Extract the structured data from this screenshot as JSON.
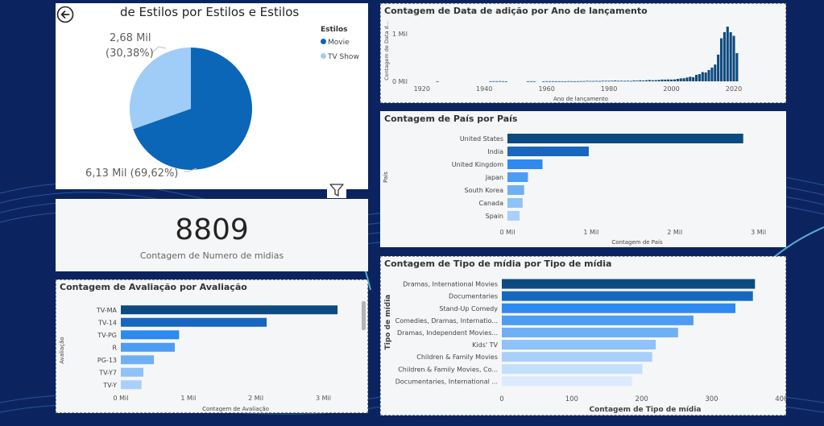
{
  "colors": {
    "background": "#0b2460",
    "movie": "#0b66b8",
    "tvshow": "#9fcdf8",
    "dark": "#0d4a80",
    "bar_palette": [
      "#0d4a80",
      "#1767c0",
      "#2e8af0",
      "#4e9cf2",
      "#6fb0f5",
      "#8ec2f8",
      "#a8d0fa",
      "#c4dffb",
      "#dbeafd"
    ]
  },
  "icons": {
    "back": "back-arrow-icon",
    "filter": "filter-icon",
    "more": "more-options-icon"
  },
  "pie": {
    "title": "Contagem de Estilos por Estilos e Estilos",
    "title_visible": "de Estilos por Estilos e Estilos",
    "legend_title": "Estilos",
    "label_tv_line1": "2,68 Mil",
    "label_tv_line2": "(30,38%)",
    "label_movie": "6,13 Mil (69,62%)",
    "chart_data": {
      "type": "pie",
      "slices": [
        {
          "name": "Movie",
          "value": 6130,
          "percent": 69.62
        },
        {
          "name": "TV Show",
          "value": 2680,
          "percent": 30.38
        }
      ]
    }
  },
  "kpi": {
    "value": "8809",
    "label": "Contagem de Numero de midias"
  },
  "rating": {
    "title": "Contagem de Avaliação por Avaliação",
    "chart_data": {
      "type": "bar",
      "orientation": "horizontal",
      "categories": [
        "TV-MA",
        "TV-14",
        "TV-PG",
        "R",
        "PG-13",
        "TV-Y7",
        "TV-Y"
      ],
      "values": [
        3210,
        2160,
        863,
        799,
        490,
        334,
        307
      ],
      "xlim": [
        0,
        3400
      ],
      "xticks": [
        0,
        1000,
        2000,
        3000
      ],
      "xtick_labels": [
        "0 Mil",
        "1 Mil",
        "2 Mil",
        "3 Mil"
      ],
      "xlabel": "Contagem de Avaliação",
      "ylabel": "Avaliação"
    }
  },
  "year": {
    "title": "Contagem de Data de adição por Ano de lançamento",
    "chart_data": {
      "type": "bar",
      "x": [
        1925,
        1942,
        1943,
        1944,
        1945,
        1946,
        1947,
        1954,
        1955,
        1956,
        1959,
        1960,
        1961,
        1962,
        1963,
        1964,
        1965,
        1966,
        1967,
        1968,
        1969,
        1970,
        1971,
        1972,
        1973,
        1974,
        1975,
        1976,
        1977,
        1978,
        1979,
        1980,
        1981,
        1982,
        1983,
        1984,
        1985,
        1986,
        1987,
        1988,
        1989,
        1990,
        1991,
        1992,
        1993,
        1994,
        1995,
        1996,
        1997,
        1998,
        1999,
        2000,
        2001,
        2002,
        2003,
        2004,
        2005,
        2006,
        2007,
        2008,
        2009,
        2010,
        2011,
        2012,
        2013,
        2014,
        2015,
        2016,
        2017,
        2018,
        2019,
        2020,
        2021
      ],
      "values": [
        1,
        2,
        3,
        3,
        4,
        3,
        1,
        2,
        3,
        2,
        1,
        4,
        3,
        3,
        2,
        2,
        2,
        1,
        5,
        3,
        2,
        3,
        5,
        5,
        10,
        7,
        7,
        9,
        7,
        12,
        11,
        11,
        13,
        17,
        11,
        12,
        10,
        13,
        8,
        18,
        16,
        22,
        17,
        23,
        28,
        22,
        25,
        29,
        38,
        36,
        39,
        37,
        40,
        51,
        61,
        64,
        80,
        96,
        88,
        136,
        152,
        194,
        185,
        237,
        288,
        352,
        560,
        902,
        1032,
        1147,
        1030,
        953,
        592
      ],
      "xlim": [
        1918,
        2028
      ],
      "ylim": [
        0,
        1300
      ],
      "xticks": [
        1920,
        1940,
        1960,
        1980,
        2000,
        2020
      ],
      "yticks": [
        0,
        1000
      ],
      "ytick_labels": [
        "0 Mil",
        "1 Mil"
      ],
      "xlabel": "Ano de lançamento",
      "ylabel": "Contagem de Data d..."
    }
  },
  "country": {
    "title": "Contagem de País por País",
    "chart_data": {
      "type": "bar",
      "orientation": "horizontal",
      "categories": [
        "United States",
        "India",
        "United Kingdom",
        "Japan",
        "South Korea",
        "Canada",
        "Spain"
      ],
      "values": [
        2818,
        972,
        419,
        245,
        199,
        181,
        145
      ],
      "xlim": [
        0,
        3100
      ],
      "xticks": [
        0,
        1000,
        2000,
        3000
      ],
      "xtick_labels": [
        "0 Mil",
        "1 Mil",
        "2 Mil",
        "3 Mil"
      ],
      "xlabel": "Contagem de País",
      "ylabel": "País"
    }
  },
  "genre": {
    "title": "Contagem de Tipo de mídia por Tipo de mídia",
    "chart_data": {
      "type": "bar",
      "orientation": "horizontal",
      "categories": [
        "Dramas, International Movies",
        "Documentaries",
        "Stand-Up Comedy",
        "Comedies, Dramas, Internatio...",
        "Dramas, Independent Movies...",
        "Kids' TV",
        "Children & Family Movies",
        "Children & Family Movies, Co...",
        "Documentaries, International ..."
      ],
      "values": [
        362,
        359,
        334,
        274,
        252,
        220,
        215,
        201,
        186
      ],
      "xlim": [
        0,
        410
      ],
      "xticks": [
        0,
        100,
        200,
        300,
        400
      ],
      "xtick_labels": [
        "0",
        "100",
        "200",
        "300",
        "400"
      ],
      "xlabel": "Contagem de Tipo de mídia",
      "ylabel": "Tipo de mídia"
    }
  }
}
